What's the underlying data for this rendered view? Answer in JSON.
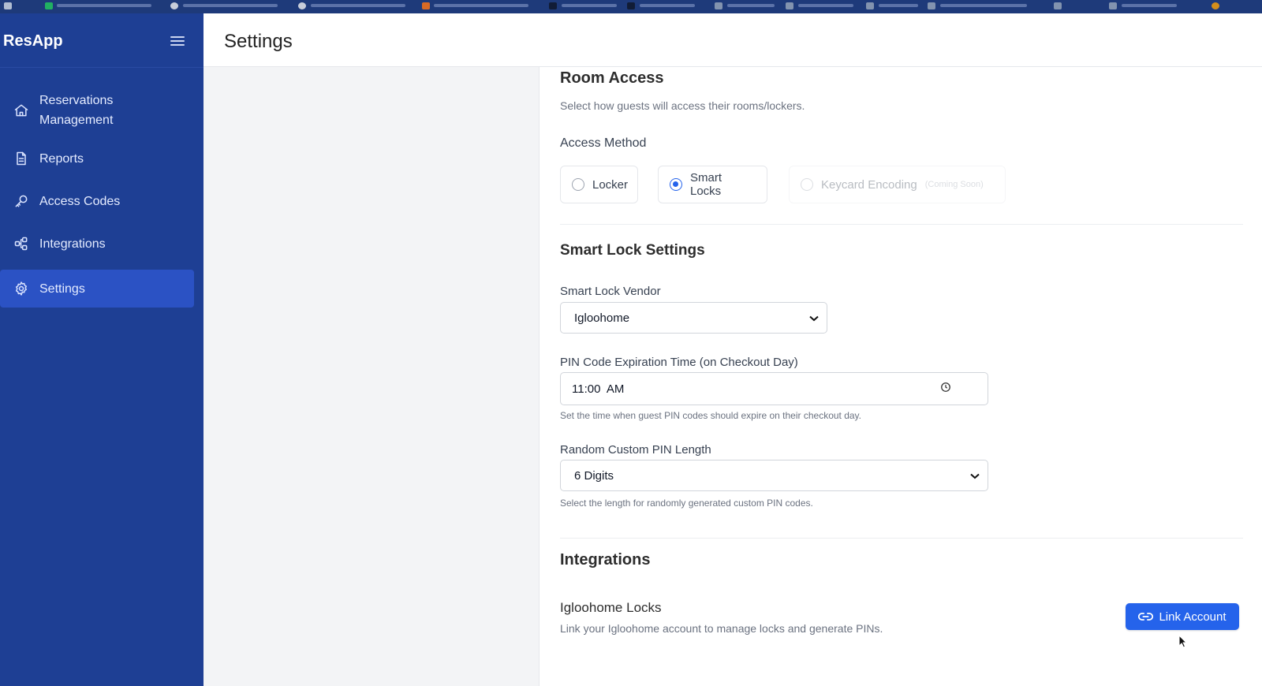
{
  "app": {
    "brand": "ResApp",
    "page_title": "Settings"
  },
  "colors": {
    "sidebar_bg": "#1e3f94",
    "sidebar_active": "#2b52c4",
    "accent": "#2563eb"
  },
  "sidebar": {
    "items": [
      {
        "label": "Reservations Management",
        "icon": "home-icon",
        "active": false
      },
      {
        "label": "Reports",
        "icon": "document-icon",
        "active": false
      },
      {
        "label": "Access Codes",
        "icon": "key-icon",
        "active": false
      },
      {
        "label": "Integrations",
        "icon": "integrations-icon",
        "active": false
      },
      {
        "label": "Settings",
        "icon": "gear-icon",
        "active": true
      }
    ]
  },
  "room_access": {
    "title": "Room Access",
    "description": "Select how guests will access their rooms/lockers.",
    "method_label": "Access Method",
    "options": [
      {
        "label": "Locker",
        "checked": false,
        "disabled": false
      },
      {
        "label": "Smart Locks",
        "checked": true,
        "disabled": false
      },
      {
        "label": "Keycard Encoding",
        "note": "(Coming Soon)",
        "checked": false,
        "disabled": true
      }
    ]
  },
  "smart_lock": {
    "title": "Smart Lock Settings",
    "vendor_label": "Smart Lock Vendor",
    "vendor_value": "Igloohome",
    "expiry_label": "PIN Code Expiration Time (on Checkout Day)",
    "expiry_value": "11:00  AM",
    "expiry_help": "Set the time when guest PIN codes should expire on their checkout day.",
    "pin_length_label": "Random Custom PIN Length",
    "pin_length_value": "6 Digits",
    "pin_length_help": "Select the length for randomly generated custom PIN codes."
  },
  "integrations": {
    "title": "Integrations",
    "item_title": "Igloohome Locks",
    "item_desc": "Link your Igloohome account to manage locks and generate PINs.",
    "button_label": "Link Account"
  }
}
